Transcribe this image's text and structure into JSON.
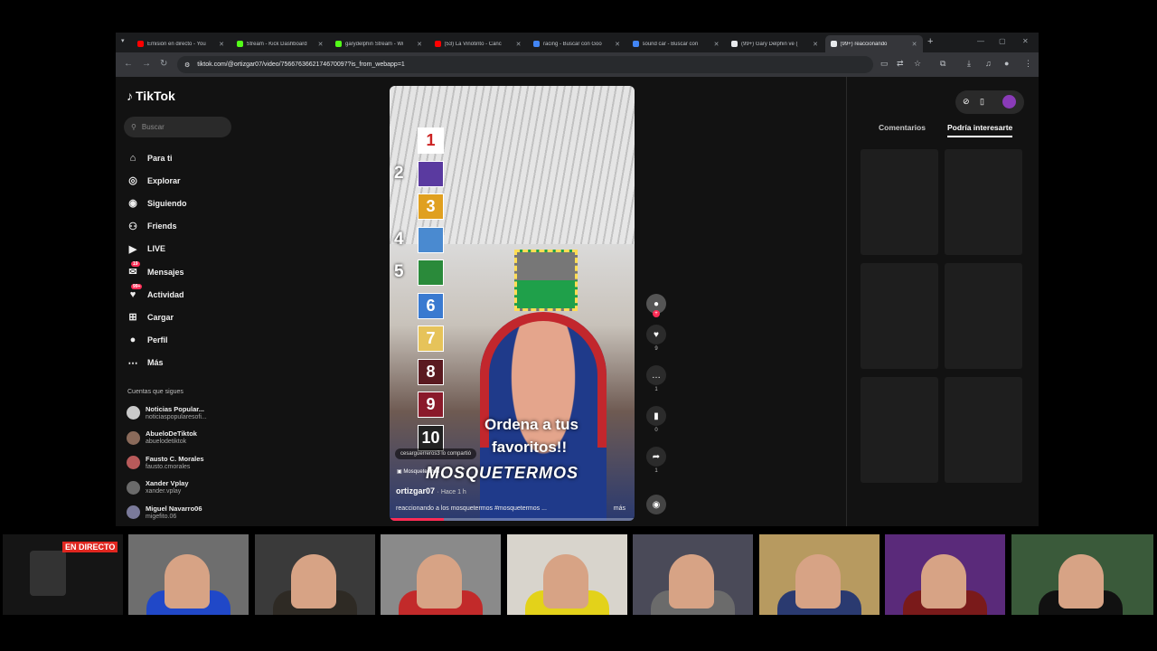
{
  "browser": {
    "tabs": [
      {
        "title": "Emisión en directo - You",
        "favicon_color": "#ff0000"
      },
      {
        "title": "Stream - Kick Dashboard",
        "favicon_color": "#53fc18"
      },
      {
        "title": "garydelphin Stream - Wi",
        "favicon_color": "#53fc18"
      },
      {
        "title": "(53) La Vinotinto - Canc",
        "favicon_color": "#ff0000"
      },
      {
        "title": "racing - Buscar con Goo",
        "favicon_color": "#4285f4"
      },
      {
        "title": "sound car - Buscar con",
        "favicon_color": "#4285f4"
      },
      {
        "title": "(99+) Gary Delphin ve (",
        "favicon_color": "#e8eaed"
      },
      {
        "title": "(99+) reaccionando",
        "favicon_color": "#e8eaed",
        "active": true
      }
    ],
    "url": "tiktok.com/@ortizgar07/video/7566763662174670097?is_from_webapp=1"
  },
  "tiktok": {
    "logo": "TikTok",
    "search_placeholder": "Buscar",
    "nav": [
      {
        "label": "Para ti",
        "icon": "home-icon"
      },
      {
        "label": "Explorar",
        "icon": "compass-icon"
      },
      {
        "label": "Siguiendo",
        "icon": "following-icon"
      },
      {
        "label": "Friends",
        "icon": "friends-icon"
      },
      {
        "label": "LIVE",
        "icon": "live-icon"
      },
      {
        "label": "Mensajes",
        "icon": "messages-icon",
        "badge": "19"
      },
      {
        "label": "Actividad",
        "icon": "activity-icon",
        "badge": "99+"
      },
      {
        "label": "Cargar",
        "icon": "upload-icon"
      },
      {
        "label": "Perfil",
        "icon": "profile-icon"
      },
      {
        "label": "Más",
        "icon": "more-icon"
      }
    ],
    "following_header": "Cuentas que sigues",
    "following": [
      {
        "name": "Noticias Popular...",
        "user": "noticiaspopularesofi..."
      },
      {
        "name": "AbueloDeTiktok",
        "user": "abuelodetiktok"
      },
      {
        "name": "Fausto C. Morales",
        "user": "fausto.cmorales"
      },
      {
        "name": "Xander Vplay",
        "user": "xander.vplay"
      },
      {
        "name": "Miguel Navarro06",
        "user": "migefito.06"
      }
    ],
    "video": {
      "ranks": [
        "1",
        "2",
        "3",
        "4",
        "5",
        "6",
        "7",
        "8",
        "9",
        "10"
      ],
      "caption_line1": "Ordena a tus",
      "caption_line2": "favoritos!!",
      "caption_line3": "MOSQUETERMOS",
      "shared_by": "cesarguerreros3 lo compartió",
      "sound_tag": "Mosquetermos",
      "author": "ortizgar07",
      "time": "Hace 1 h",
      "description": "reaccionando a los mosquetermos #mosquetermos ...",
      "more": "más",
      "progress": 0.22
    },
    "actions": [
      {
        "name": "like",
        "count": "9"
      },
      {
        "name": "comment",
        "count": "1"
      },
      {
        "name": "bookmark",
        "count": "0"
      },
      {
        "name": "share",
        "count": "1"
      }
    ],
    "right_tabs": [
      "Comentarios",
      "Podría interesarte"
    ]
  },
  "overlay": {
    "live_badge": "EN DIRECTO"
  },
  "colors": {
    "accent": "#fe2c55",
    "page_bg": "#121212"
  }
}
